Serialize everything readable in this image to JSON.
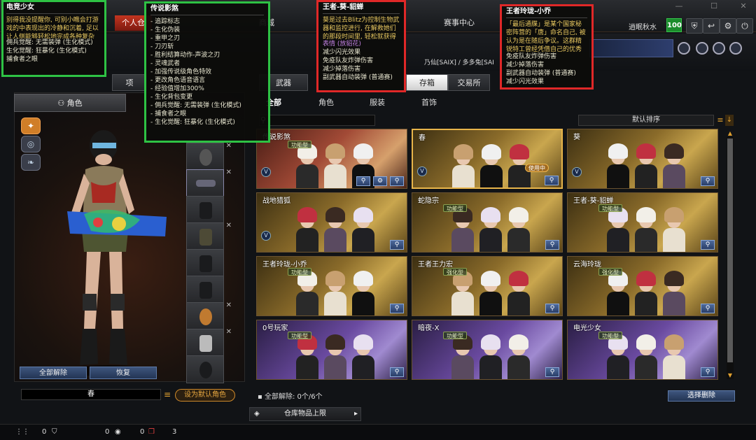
{
  "top_nav": {
    "tabs": [
      {
        "label": "个人仓",
        "active": true
      },
      {
        "label": "商城",
        "active": false
      },
      {
        "label": "赛事中心",
        "active": false
      }
    ],
    "level": "100",
    "user_name": "逍眠秋水"
  },
  "rank_strip": "乃仙[SAIX] / 多多兔[SAI",
  "main_tabs": [
    "武器",
    "存箱",
    "交易所"
  ],
  "left_tab": {
    "label": "角色"
  },
  "sub_tabs": [
    {
      "label": "全部",
      "active": true
    },
    {
      "label": "角色",
      "active": false
    },
    {
      "label": "服装",
      "active": false
    },
    {
      "label": "首饰",
      "active": false
    }
  ],
  "left_panel": {
    "remove_all_label": "全部解除",
    "restore_label": "恢复",
    "character_name": "春",
    "set_default_label": "设为默认角色"
  },
  "grid": {
    "sort_label": "默认排序",
    "cards": [
      {
        "name": "传说影煞",
        "tag": "功能型",
        "theme": "red",
        "selected": false,
        "in_use": "",
        "buttons": 3
      },
      {
        "name": "春",
        "tag": "",
        "theme": "gold",
        "selected": true,
        "in_use": "使用中",
        "buttons": 1
      },
      {
        "name": "葵",
        "tag": "",
        "theme": "gold",
        "selected": false,
        "in_use": "",
        "buttons": 1
      },
      {
        "name": "战地猎狐",
        "tag": "",
        "theme": "gold",
        "selected": false,
        "in_use": "",
        "buttons": 1
      },
      {
        "name": "蛇隐宗",
        "tag": "功能型",
        "theme": "gold",
        "selected": false,
        "in_use": "",
        "buttons": 1
      },
      {
        "name": "王者-葵-貂蝉",
        "tag": "功能型",
        "theme": "gold",
        "selected": false,
        "in_use": "",
        "buttons": 1
      },
      {
        "name": "王者玲珑-小乔",
        "tag": "功能型",
        "theme": "gold",
        "selected": false,
        "in_use": "",
        "buttons": 1
      },
      {
        "name": "王者王力宏",
        "tag": "强化型",
        "theme": "gold",
        "selected": false,
        "in_use": "",
        "buttons": 1
      },
      {
        "name": "云海玲珑",
        "tag": "强化型",
        "theme": "gold",
        "selected": false,
        "in_use": "",
        "buttons": 1
      },
      {
        "name": "0号玩家",
        "tag": "功能型",
        "theme": "purple",
        "selected": false,
        "in_use": "",
        "buttons": 1
      },
      {
        "name": "暗夜-X",
        "tag": "功能型",
        "theme": "purple",
        "selected": false,
        "in_use": "",
        "buttons": 1
      },
      {
        "name": "电光少女",
        "tag": "功能型",
        "theme": "purple",
        "selected": false,
        "in_use": "",
        "buttons": 1
      }
    ],
    "remove_all_count": "全部解除: 0个/6个",
    "select_delete_label": "选择删除",
    "storage_limit_label": "仓库物品上限"
  },
  "status_bar": {
    "a": "0",
    "b": "0",
    "c": "0",
    "d": "3"
  },
  "tooltips": {
    "dianguang": {
      "title": "电竞少女",
      "desc": "别得我没提醒你, 可别小瞧会打游戏的中表现出的冷静和沉着, 足以让人侧能够轻松地完成各种复杂的操作, 合被她们堵叮个不停啊。",
      "lines": [
        "佣兵觉醒: 无需装弹 (生化模式)",
        "生化觉醒: 狂暴化 (生化模式)",
        "捕食者之眼"
      ]
    },
    "chuanshuo": {
      "title": "传说影煞",
      "lines": [
        "- 追踪标志",
        "- 生化伪装",
        "- 重甲之刃",
        "- 刀刃斩",
        "- 胜利结算动作-声波之刃",
        "- 灵魂武者",
        "- 加强传说级角色特效",
        "- 更改角色语音语言",
        "- 经验值增加300%",
        "- 生化背包变更",
        "- 佣兵觉醒: 无需装弹 (生化模式)",
        "- 捕食者之眼",
        "- 生化觉醒: 狂暴化 (生化模式)"
      ]
    },
    "kui": {
      "title": "王者-葵-貂蝉",
      "desc": "葵是过去Blitz为控制生物武器和监控进行, 在解救她们的那段时间里, 轻松就获得了「王者」称号。",
      "accent": "表情 (放貂花)",
      "lines": [
        "减少闪光效果",
        "免疫队友炸弹伤害",
        "减少掉落伤害",
        "副武器自动装弹 (普通赛)"
      ]
    },
    "xiaoqiao": {
      "title": "王者玲珑-小乔",
      "desc": "「最后通牒」是某个国家秘密阵营的「唐」命名自己, 被认为是在随后争议。这群精锐特工曾经凭借自己的优秀将某些传统色彩和流行元素进行了融合。",
      "lines": [
        "免疫队友炸弹伤害",
        "减少掉落伤害",
        "副武器自动装弹 (普通赛)",
        "减少闪光效果"
      ]
    }
  },
  "colors": {
    "accent_red": "#c43520",
    "gold": "#e8b54a",
    "annotation_green": "#2ec244",
    "annotation_red": "#e02828"
  }
}
